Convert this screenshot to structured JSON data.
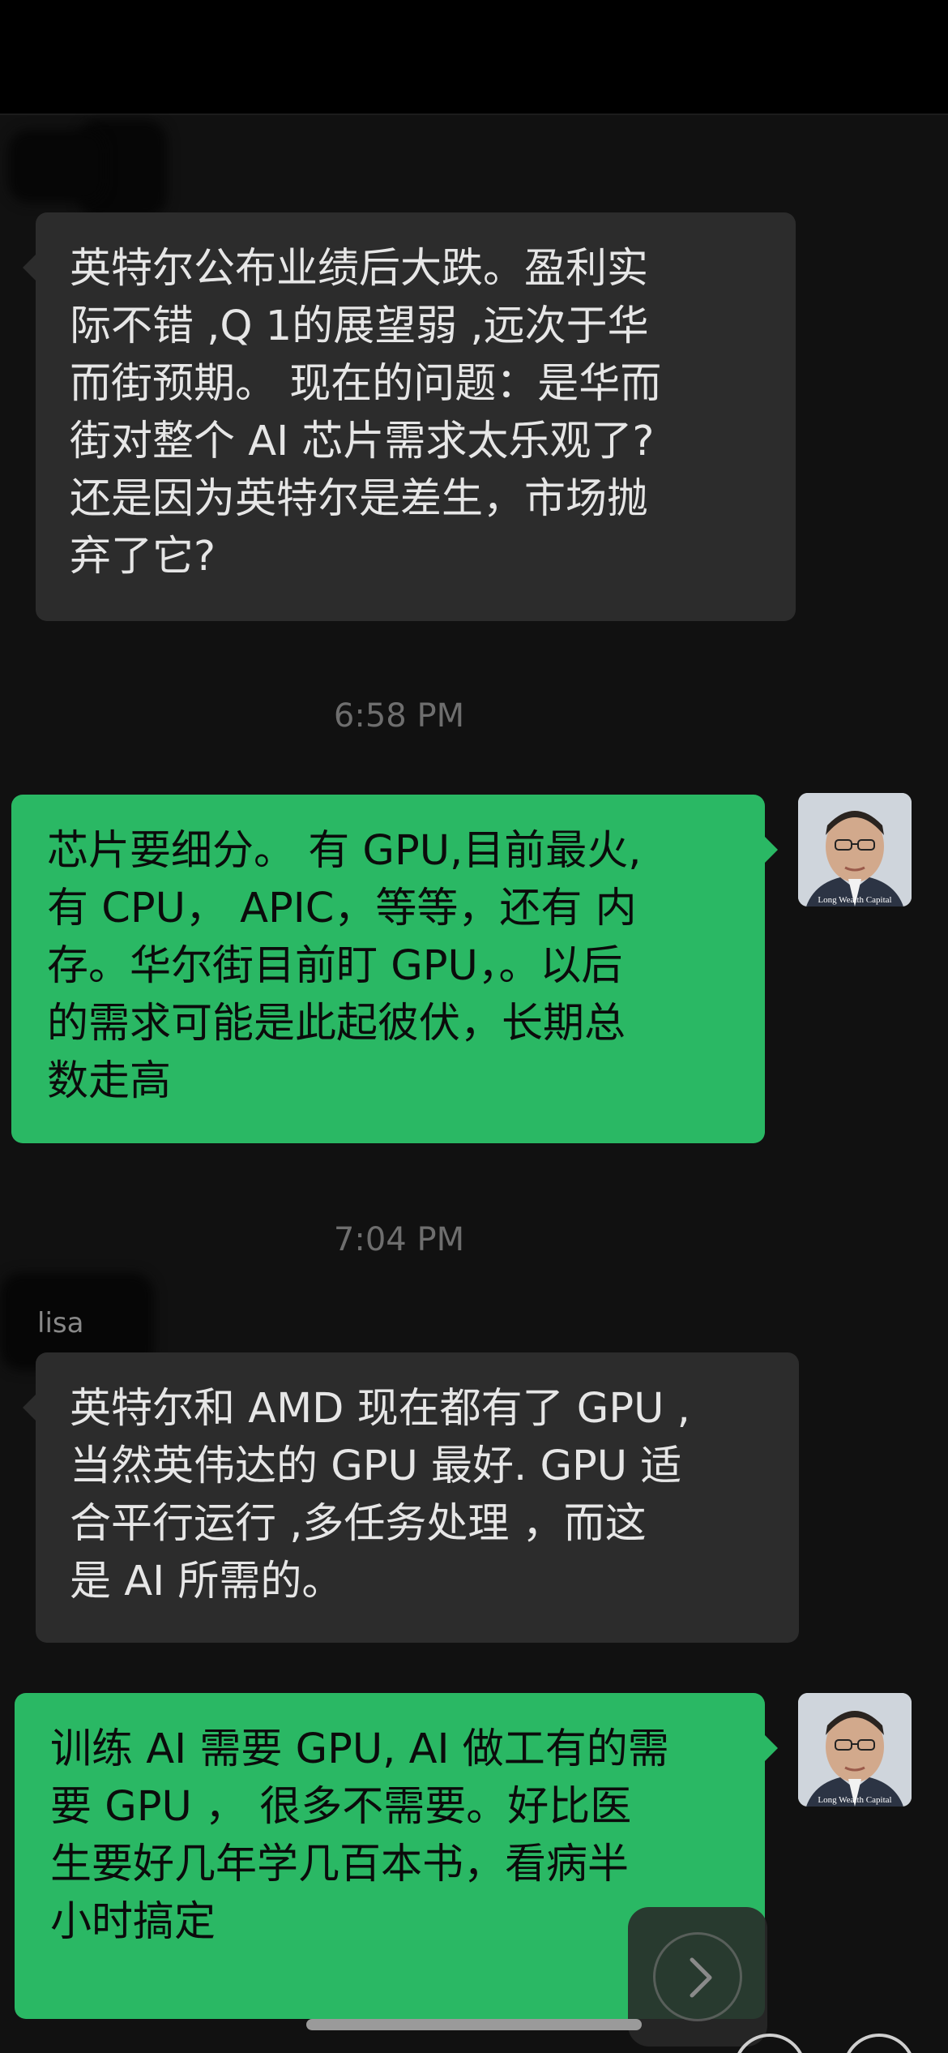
{
  "conversation": {
    "messages": [
      {
        "text": "英特尔公布业绩后大跌。盈利实\n际不错 ,Q 1的展望弱 ,远次于华\n而街预期。 现在的问题：是华而\n街对整个 AI 芯片需求太乐观了?\n还是因为英特尔是差生，市场抛\n弃了它?"
      },
      {
        "time": "6:58 PM",
        "text": "芯片要细分。 有 GPU,目前最火,\n有 CPU，  APIC，等等，还有 内\n存。华尔街目前盯 GPU，。以后\n的需求可能是此起彼伏，长期总\n数走高"
      },
      {
        "time": "7:04 PM",
        "sender": "lisa",
        "text": "英特尔和 AMD 现在都有了 GPU ,\n当然英伟达的 GPU 最好.  GPU 适\n合平行运行 ,多任务处理  ，而这\n是 AI 所需的。"
      },
      {
        "text": "训练 AI 需要 GPU, AI 做工有的需\n要 GPU ，  很多不需要。好比医\n生要好几年学几百本书，看病半\n小时搞定"
      }
    ]
  },
  "avatar": {
    "icon": "person-portrait",
    "logo_text": "Long Wealth Capital"
  },
  "controls": {
    "next_icon": "chevron-right-icon"
  },
  "colors": {
    "background": "#111111",
    "incoming_bubble": "#2c2c2c",
    "outgoing_bubble": "#2ab864",
    "timestamp": "#6e6e6e"
  }
}
